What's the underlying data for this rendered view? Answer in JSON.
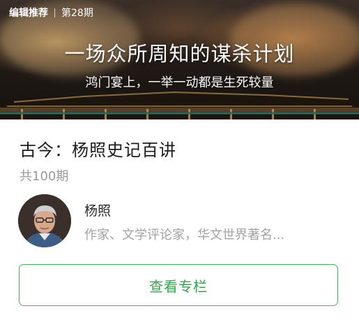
{
  "banner": {
    "tag": "编辑推荐",
    "issue": "第28期",
    "title": "一场众所周知的谋杀计划",
    "subtitle": "鸿门宴上，一举一动都是生死较量"
  },
  "course": {
    "title": "古今：杨照史记百讲",
    "count": "共100期"
  },
  "author": {
    "name": "杨照",
    "description": "作家、文学评论家，华文世界著名..."
  },
  "action": {
    "label": "查看专栏"
  },
  "colors": {
    "accent": "#2daa4a",
    "border": "#3cb95a",
    "muted": "#9a9a9a"
  }
}
